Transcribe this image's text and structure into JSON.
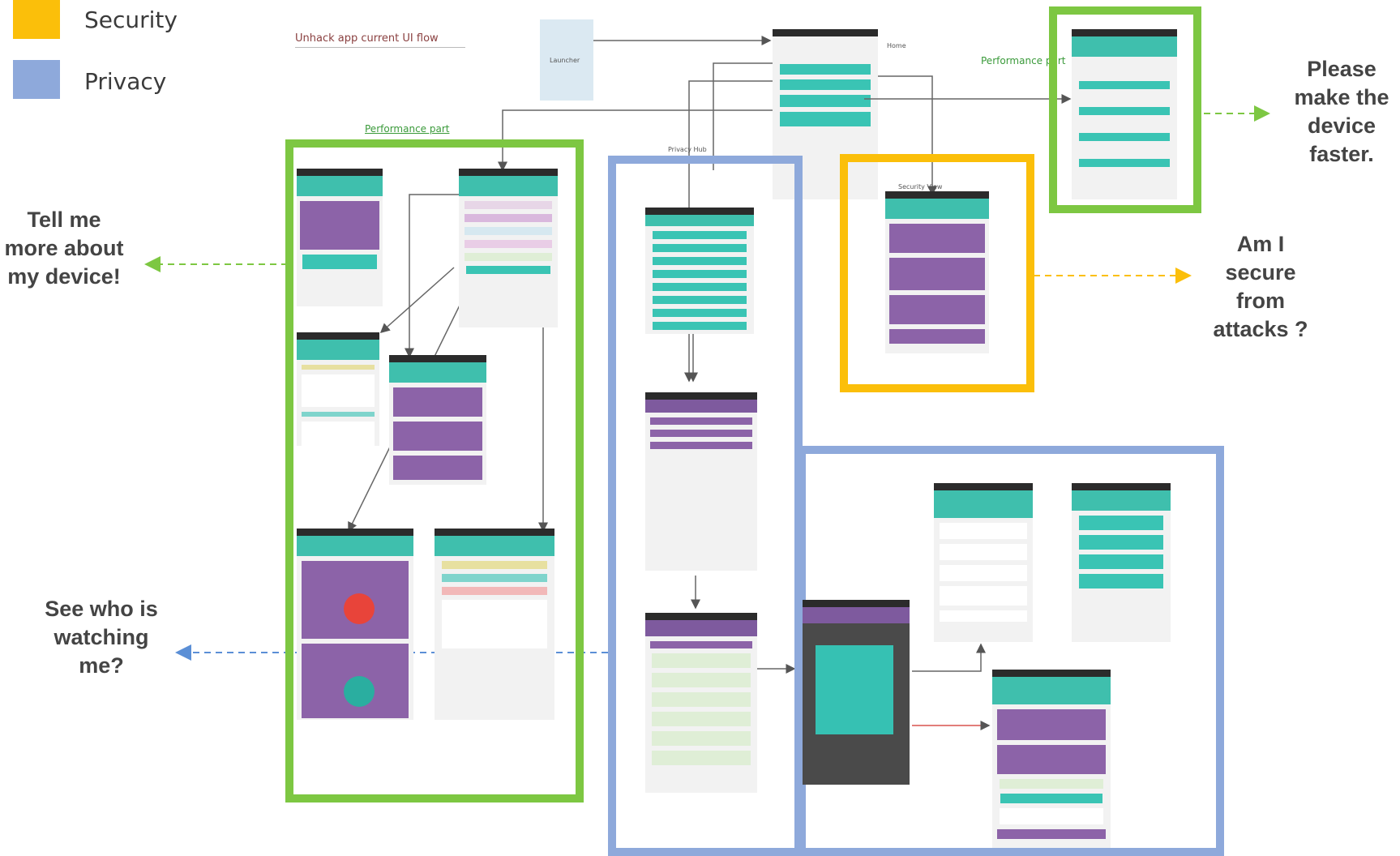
{
  "legend": {
    "items": [
      {
        "label": "Security",
        "color": "#fbbf0a"
      },
      {
        "label": "Privacy",
        "color": "#8ea9db"
      }
    ]
  },
  "callouts": {
    "performance_top": "Please make the device faster.",
    "performance_left": "Tell me more about my device!",
    "security": "Am I secure from attacks ?",
    "privacy": "See who is watching me?"
  },
  "sketch_labels": {
    "flow_title": "Unhack app current UI flow",
    "launcher": "Launcher",
    "performance_part_1": "Performance part",
    "performance_part_2": "Performance part",
    "privacy_hub": "Privacy Hub",
    "security_view": "Security View",
    "home": "Home"
  },
  "colors": {
    "performance": "#7dc742",
    "security": "#fbbf0a",
    "privacy": "#8ea9db",
    "arrow_privacy": "#5b8fd6",
    "teal": "#3fbfad",
    "purple": "#8c63a8"
  }
}
